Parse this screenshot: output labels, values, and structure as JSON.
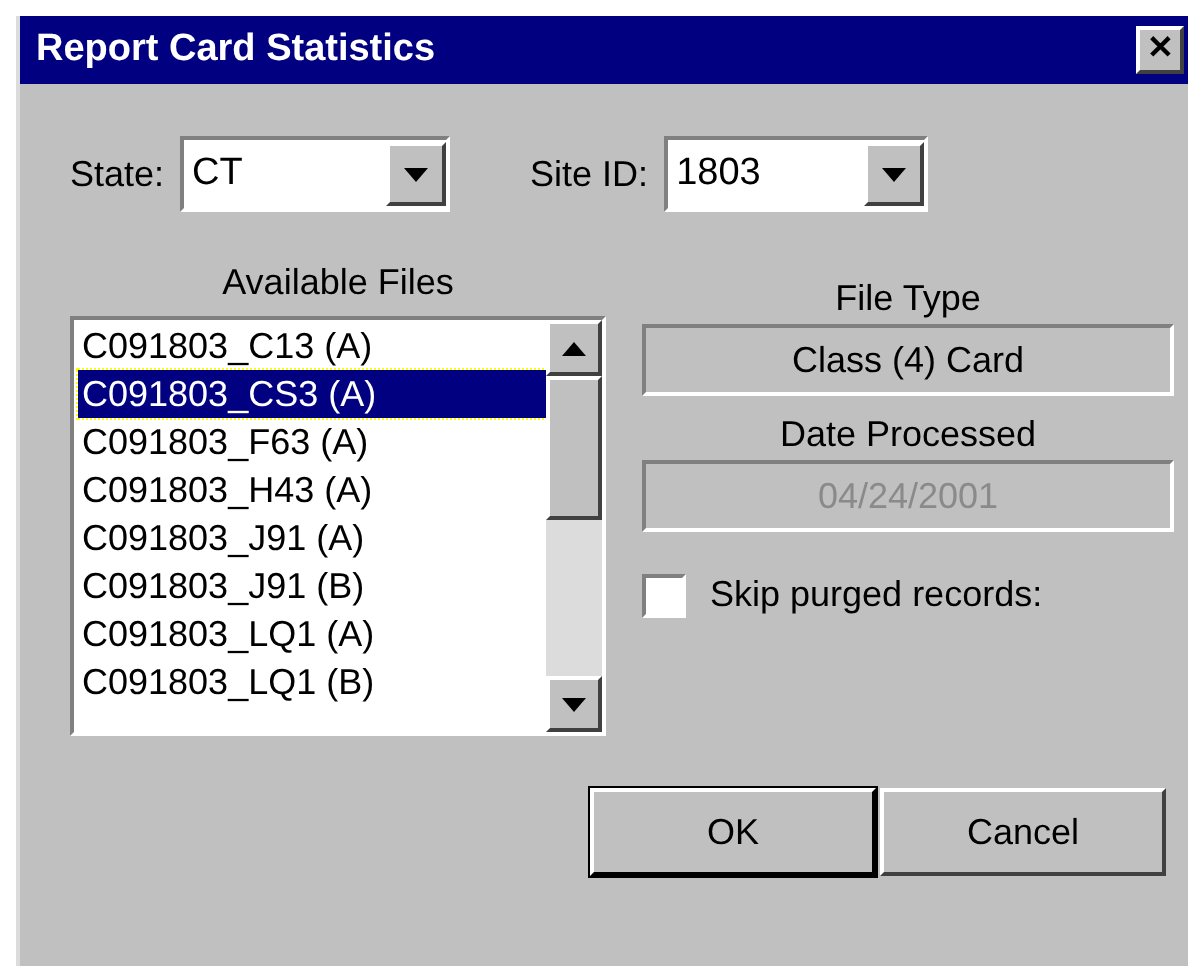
{
  "window": {
    "title": "Report Card Statistics",
    "close": "✕"
  },
  "state": {
    "label": "State:",
    "value": "CT"
  },
  "site_id": {
    "label": "Site ID:",
    "value": "1803"
  },
  "available_files": {
    "label": "Available Files",
    "items": [
      {
        "name": "C091803_C13 (A)",
        "selected": false
      },
      {
        "name": "C091803_CS3 (A)",
        "selected": true
      },
      {
        "name": "C091803_F63 (A)",
        "selected": false
      },
      {
        "name": "C091803_H43 (A)",
        "selected": false
      },
      {
        "name": "C091803_J91 (A)",
        "selected": false
      },
      {
        "name": "C091803_J91 (B)",
        "selected": false
      },
      {
        "name": "C091803_LQ1 (A)",
        "selected": false
      },
      {
        "name": "C091803_LQ1 (B)",
        "selected": false
      }
    ]
  },
  "file_type": {
    "label": "File Type",
    "value": "Class (4) Card",
    "disabled": false
  },
  "date_processed": {
    "label": "Date Processed",
    "value": "04/24/2001",
    "disabled": true
  },
  "skip_purged": {
    "label": "Skip purged records:",
    "checked": false
  },
  "buttons": [
    {
      "label": "OK",
      "default": true
    },
    {
      "label": "Cancel",
      "default": false
    }
  ]
}
